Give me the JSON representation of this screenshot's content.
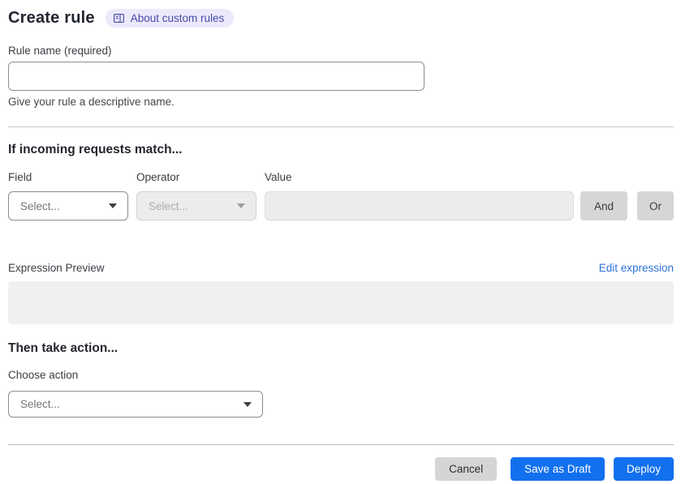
{
  "header": {
    "title": "Create rule",
    "about_link_label": "About custom rules"
  },
  "rule_name": {
    "label": "Rule name (required)",
    "value": "",
    "helper": "Give your rule a descriptive name."
  },
  "match_section": {
    "heading": "If incoming requests match...",
    "field": {
      "label": "Field",
      "placeholder": "Select..."
    },
    "operator": {
      "label": "Operator",
      "placeholder": "Select..."
    },
    "value": {
      "label": "Value",
      "value": ""
    },
    "and_button_label": "And",
    "or_button_label": "Or",
    "expression_preview_label": "Expression Preview",
    "edit_expression_link": "Edit expression",
    "expression_value": ""
  },
  "action_section": {
    "heading": "Then take action...",
    "choose_action_label": "Choose action",
    "action_placeholder": "Select..."
  },
  "footer": {
    "cancel_label": "Cancel",
    "save_draft_label": "Save as Draft",
    "deploy_label": "Deploy"
  },
  "icons": {
    "about_badge": "book-icon",
    "selects": "caret-down-icon"
  },
  "colors": {
    "primary_blue": "#1270ee",
    "link_blue": "#2d71d8",
    "badge_bg": "#eceafa",
    "badge_text": "#4549ac",
    "disabled_bg": "#ececec",
    "neutral_button_bg": "#d6d6d6"
  }
}
